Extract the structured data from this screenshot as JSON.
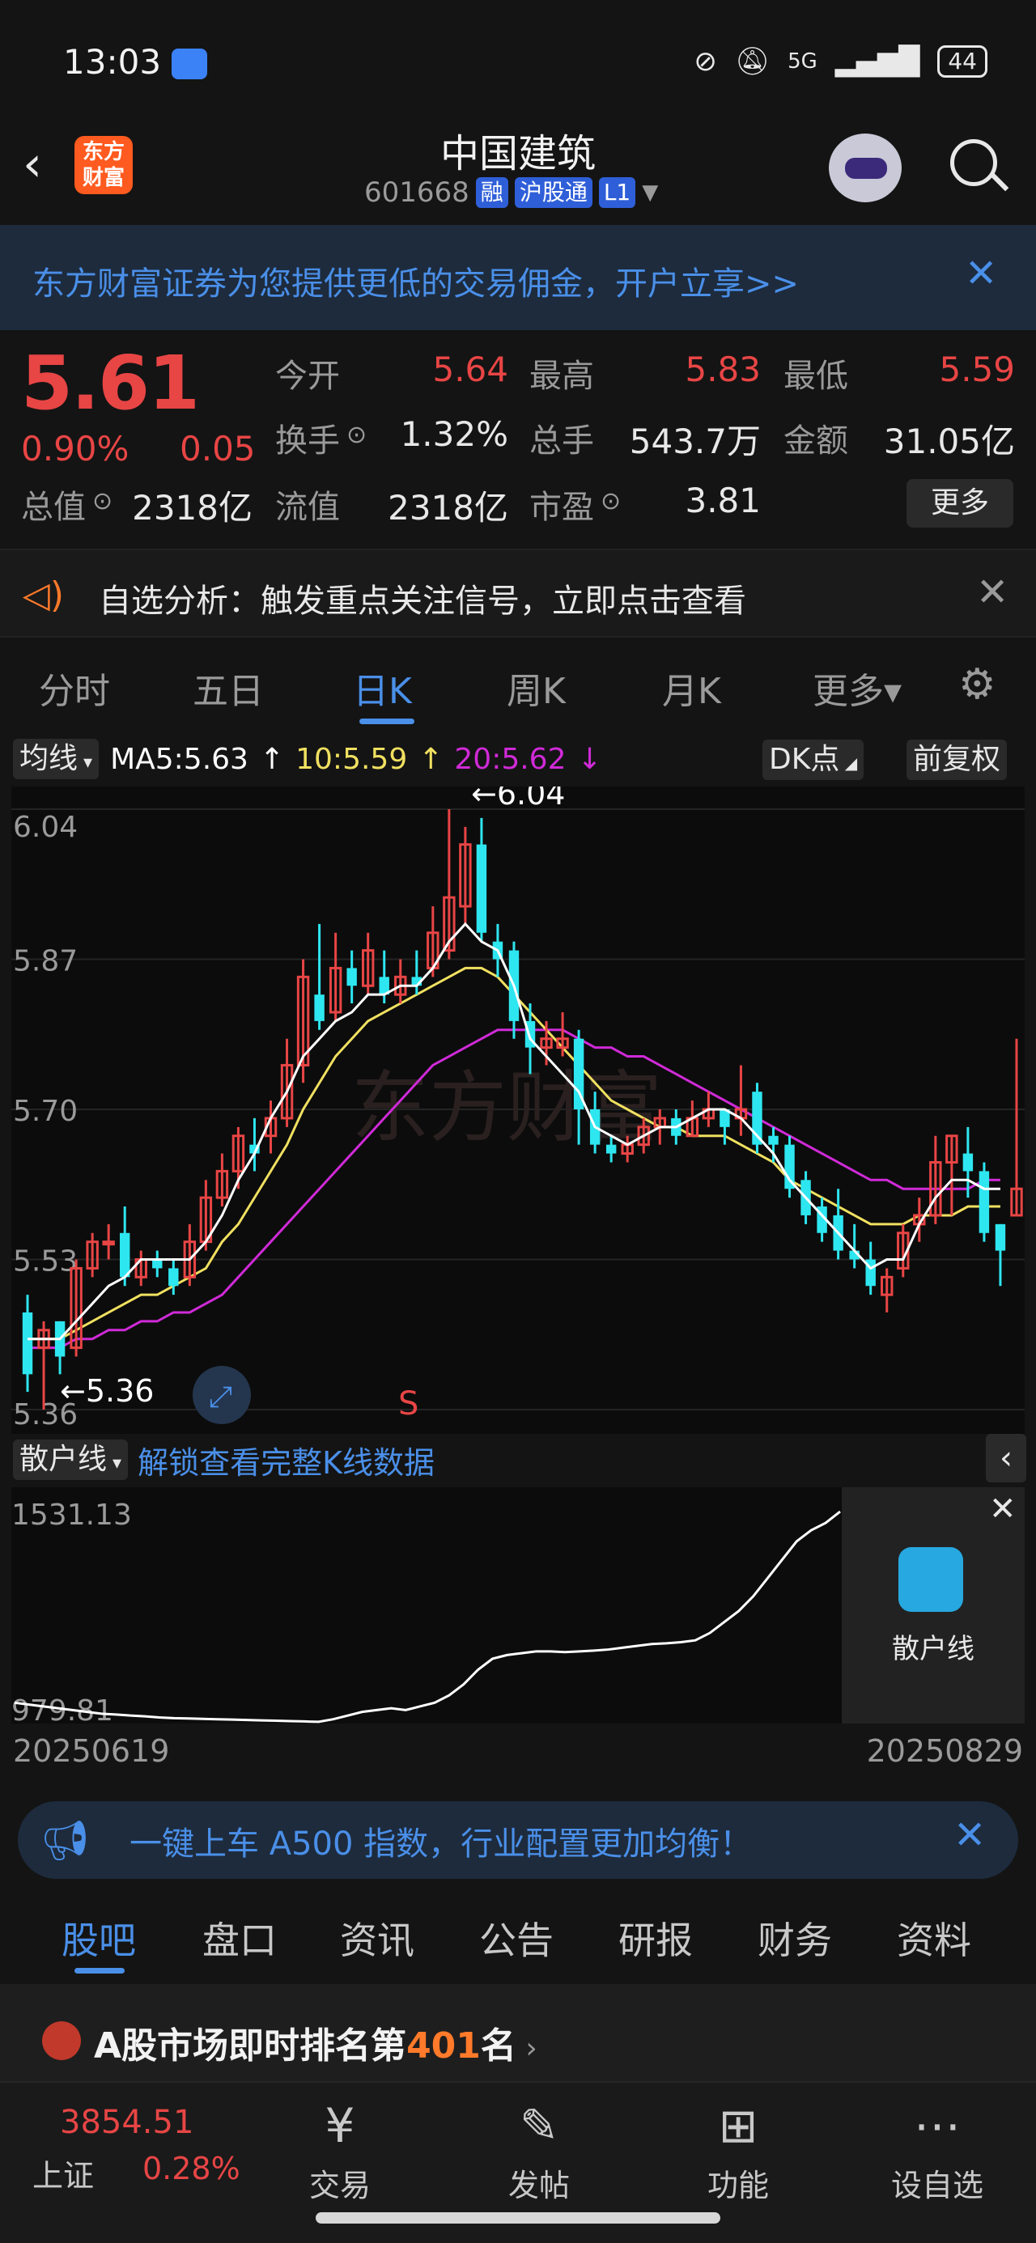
{
  "status_bar": {
    "time": "13:03",
    "network": "5G",
    "battery": "44"
  },
  "header": {
    "stock_name": "中国建筑",
    "code": "601668",
    "tags": [
      "融",
      "沪股通",
      "L1"
    ],
    "logo_text_line1": "东方",
    "logo_text_line2": "财富"
  },
  "promo": {
    "text": "东方财富证券为您提供更低的交易佣金，开户立享>>"
  },
  "quote": {
    "price": "5.61",
    "change_pct": "0.90%",
    "change": "0.05",
    "stats": [
      {
        "label": "今开",
        "value": "5.64",
        "color": "red"
      },
      {
        "label": "最高",
        "value": "5.83",
        "color": "red"
      },
      {
        "label": "最低",
        "value": "5.59",
        "color": "red"
      },
      {
        "label": "换手",
        "value": "1.32%",
        "color": "white"
      },
      {
        "label": "总手",
        "value": "543.7万",
        "color": "white"
      },
      {
        "label": "金额",
        "value": "31.05亿",
        "color": "white"
      },
      {
        "label": "总值",
        "value": "2318亿",
        "color": "white"
      },
      {
        "label": "流值",
        "value": "2318亿",
        "color": "white"
      },
      {
        "label": "市盈",
        "value": "3.81",
        "color": "white"
      }
    ],
    "more_label": "更多"
  },
  "analysis": {
    "text": "自选分析：触发重点关注信号，立即点击查看"
  },
  "tabs": [
    {
      "label": "分时",
      "active": false
    },
    {
      "label": "五日",
      "active": false
    },
    {
      "label": "日K",
      "active": true
    },
    {
      "label": "周K",
      "active": false
    },
    {
      "label": "月K",
      "active": false
    },
    {
      "label": "更多▾",
      "active": false
    }
  ],
  "ma_row": {
    "selector": "均线",
    "ma5": "MA5:5.63",
    "ma10": "10:5.59",
    "ma20": "20:5.62",
    "dk": "DK点",
    "adjust": "前复权"
  },
  "colors": {
    "up": "#e84545",
    "down": "#2ee6f0",
    "ma5": "#ffffff",
    "ma10": "#f0e060",
    "ma20": "#d02ad8",
    "accent": "#4a8fe8"
  },
  "chart_data": {
    "type": "candlestick",
    "y_ticks": [
      "6.04",
      "5.87",
      "5.70",
      "5.53",
      "5.36"
    ],
    "ylim": [
      5.36,
      6.04
    ],
    "max_label": "6.04",
    "min_label": "5.36",
    "signal_label": "S",
    "watermark": "东方财富",
    "candles": [
      {
        "o": 5.47,
        "c": 5.4,
        "h": 5.49,
        "l": 5.38
      },
      {
        "o": 5.43,
        "c": 5.45,
        "h": 5.46,
        "l": 5.36
      },
      {
        "o": 5.46,
        "c": 5.42,
        "h": 5.46,
        "l": 5.4
      },
      {
        "o": 5.43,
        "c": 5.52,
        "h": 5.53,
        "l": 5.42
      },
      {
        "o": 5.52,
        "c": 5.55,
        "h": 5.56,
        "l": 5.51
      },
      {
        "o": 5.55,
        "c": 5.55,
        "h": 5.57,
        "l": 5.53
      },
      {
        "o": 5.56,
        "c": 5.51,
        "h": 5.59,
        "l": 5.5
      },
      {
        "o": 5.51,
        "c": 5.53,
        "h": 5.54,
        "l": 5.5
      },
      {
        "o": 5.53,
        "c": 5.52,
        "h": 5.54,
        "l": 5.51
      },
      {
        "o": 5.52,
        "c": 5.5,
        "h": 5.53,
        "l": 5.49
      },
      {
        "o": 5.51,
        "c": 5.55,
        "h": 5.57,
        "l": 5.5
      },
      {
        "o": 5.55,
        "c": 5.6,
        "h": 5.62,
        "l": 5.54
      },
      {
        "o": 5.6,
        "c": 5.63,
        "h": 5.65,
        "l": 5.59
      },
      {
        "o": 5.63,
        "c": 5.67,
        "h": 5.68,
        "l": 5.61
      },
      {
        "o": 5.66,
        "c": 5.65,
        "h": 5.69,
        "l": 5.63
      },
      {
        "o": 5.67,
        "c": 5.69,
        "h": 5.71,
        "l": 5.65
      },
      {
        "o": 5.69,
        "c": 5.75,
        "h": 5.78,
        "l": 5.68
      },
      {
        "o": 5.75,
        "c": 5.85,
        "h": 5.87,
        "l": 5.73
      },
      {
        "o": 5.83,
        "c": 5.8,
        "h": 5.91,
        "l": 5.79
      },
      {
        "o": 5.81,
        "c": 5.86,
        "h": 5.9,
        "l": 5.8
      },
      {
        "o": 5.86,
        "c": 5.84,
        "h": 5.88,
        "l": 5.82
      },
      {
        "o": 5.84,
        "c": 5.88,
        "h": 5.9,
        "l": 5.83
      },
      {
        "o": 5.85,
        "c": 5.83,
        "h": 5.88,
        "l": 5.82
      },
      {
        "o": 5.83,
        "c": 5.85,
        "h": 5.87,
        "l": 5.82
      },
      {
        "o": 5.85,
        "c": 5.84,
        "h": 5.88,
        "l": 5.83
      },
      {
        "o": 5.86,
        "c": 5.9,
        "h": 5.93,
        "l": 5.85
      },
      {
        "o": 5.88,
        "c": 5.94,
        "h": 6.04,
        "l": 5.87
      },
      {
        "o": 5.93,
        "c": 6.0,
        "h": 6.02,
        "l": 5.91
      },
      {
        "o": 6.0,
        "c": 5.9,
        "h": 6.03,
        "l": 5.89
      },
      {
        "o": 5.89,
        "c": 5.87,
        "h": 5.91,
        "l": 5.85
      },
      {
        "o": 5.88,
        "c": 5.8,
        "h": 5.89,
        "l": 5.78
      },
      {
        "o": 5.8,
        "c": 5.77,
        "h": 5.82,
        "l": 5.74
      },
      {
        "o": 5.77,
        "c": 5.78,
        "h": 5.8,
        "l": 5.75
      },
      {
        "o": 5.77,
        "c": 5.78,
        "h": 5.81,
        "l": 5.76
      },
      {
        "o": 5.78,
        "c": 5.7,
        "h": 5.79,
        "l": 5.66
      },
      {
        "o": 5.7,
        "c": 5.66,
        "h": 5.72,
        "l": 5.65
      },
      {
        "o": 5.66,
        "c": 5.65,
        "h": 5.67,
        "l": 5.64
      },
      {
        "o": 5.65,
        "c": 5.66,
        "h": 5.67,
        "l": 5.64
      },
      {
        "o": 5.66,
        "c": 5.68,
        "h": 5.69,
        "l": 5.65
      },
      {
        "o": 5.68,
        "c": 5.69,
        "h": 5.7,
        "l": 5.66
      },
      {
        "o": 5.69,
        "c": 5.67,
        "h": 5.7,
        "l": 5.66
      },
      {
        "o": 5.67,
        "c": 5.69,
        "h": 5.71,
        "l": 5.67
      },
      {
        "o": 5.69,
        "c": 5.7,
        "h": 5.72,
        "l": 5.68
      },
      {
        "o": 5.7,
        "c": 5.68,
        "h": 5.7,
        "l": 5.66
      },
      {
        "o": 5.69,
        "c": 5.7,
        "h": 5.75,
        "l": 5.67
      },
      {
        "o": 5.72,
        "c": 5.66,
        "h": 5.73,
        "l": 5.65
      },
      {
        "o": 5.67,
        "c": 5.66,
        "h": 5.68,
        "l": 5.64
      },
      {
        "o": 5.66,
        "c": 5.61,
        "h": 5.67,
        "l": 5.6
      },
      {
        "o": 5.62,
        "c": 5.58,
        "h": 5.63,
        "l": 5.57
      },
      {
        "o": 5.59,
        "c": 5.56,
        "h": 5.6,
        "l": 5.55
      },
      {
        "o": 5.58,
        "c": 5.54,
        "h": 5.61,
        "l": 5.53
      },
      {
        "o": 5.54,
        "c": 5.53,
        "h": 5.57,
        "l": 5.52
      },
      {
        "o": 5.53,
        "c": 5.5,
        "h": 5.55,
        "l": 5.49
      },
      {
        "o": 5.49,
        "c": 5.51,
        "h": 5.52,
        "l": 5.47
      },
      {
        "o": 5.52,
        "c": 5.56,
        "h": 5.57,
        "l": 5.51
      },
      {
        "o": 5.57,
        "c": 5.58,
        "h": 5.6,
        "l": 5.55
      },
      {
        "o": 5.58,
        "c": 5.64,
        "h": 5.67,
        "l": 5.57
      },
      {
        "o": 5.64,
        "c": 5.67,
        "h": 5.67,
        "l": 5.58
      },
      {
        "o": 5.65,
        "c": 5.63,
        "h": 5.68,
        "l": 5.6
      },
      {
        "o": 5.63,
        "c": 5.56,
        "h": 5.64,
        "l": 5.55
      },
      {
        "o": 5.57,
        "c": 5.54,
        "h": 5.57,
        "l": 5.5
      },
      {
        "o": 5.58,
        "c": 5.61,
        "h": 5.78,
        "l": 5.58
      }
    ],
    "ma5": [
      5.44,
      5.44,
      5.44,
      5.46,
      5.48,
      5.5,
      5.51,
      5.53,
      5.53,
      5.53,
      5.53,
      5.55,
      5.58,
      5.62,
      5.65,
      5.69,
      5.72,
      5.76,
      5.78,
      5.8,
      5.81,
      5.83,
      5.83,
      5.84,
      5.84,
      5.86,
      5.89,
      5.91,
      5.89,
      5.88,
      5.84,
      5.78,
      5.76,
      5.74,
      5.72,
      5.68,
      5.67,
      5.66,
      5.67,
      5.68,
      5.68,
      5.69,
      5.7,
      5.7,
      5.69,
      5.67,
      5.65,
      5.62,
      5.6,
      5.58,
      5.56,
      5.54,
      5.52,
      5.53,
      5.53,
      5.57,
      5.6,
      5.62,
      5.62,
      5.61,
      5.61
    ],
    "ma10": [
      5.44,
      5.44,
      5.44,
      5.45,
      5.46,
      5.47,
      5.48,
      5.49,
      5.49,
      5.5,
      5.51,
      5.52,
      5.55,
      5.57,
      5.6,
      5.63,
      5.66,
      5.7,
      5.73,
      5.76,
      5.78,
      5.8,
      5.81,
      5.82,
      5.83,
      5.84,
      5.85,
      5.86,
      5.86,
      5.85,
      5.83,
      5.81,
      5.79,
      5.77,
      5.75,
      5.73,
      5.71,
      5.7,
      5.69,
      5.68,
      5.68,
      5.67,
      5.67,
      5.67,
      5.66,
      5.65,
      5.64,
      5.62,
      5.61,
      5.6,
      5.59,
      5.58,
      5.57,
      5.57,
      5.57,
      5.58,
      5.58,
      5.58,
      5.59,
      5.59,
      5.59
    ],
    "ma20": [
      5.43,
      5.43,
      5.43,
      5.44,
      5.44,
      5.45,
      5.45,
      5.46,
      5.46,
      5.47,
      5.47,
      5.48,
      5.49,
      5.51,
      5.53,
      5.55,
      5.57,
      5.59,
      5.61,
      5.63,
      5.65,
      5.67,
      5.69,
      5.71,
      5.73,
      5.75,
      5.76,
      5.77,
      5.78,
      5.79,
      5.79,
      5.79,
      5.79,
      5.79,
      5.78,
      5.77,
      5.77,
      5.76,
      5.76,
      5.75,
      5.74,
      5.73,
      5.72,
      5.71,
      5.7,
      5.69,
      5.68,
      5.67,
      5.66,
      5.65,
      5.64,
      5.63,
      5.62,
      5.62,
      5.61,
      5.61,
      5.61,
      5.61,
      5.61,
      5.62,
      5.62
    ]
  },
  "sub_indicator": {
    "selector": "散户线",
    "unlock_text": "解锁查看完整K线数据",
    "max_label": "1531.13",
    "min_label": "979.81",
    "lock_label": "散户线",
    "values": [
      1010,
      1005,
      1000,
      995,
      990,
      985,
      980,
      978,
      975,
      973,
      970,
      968,
      967,
      966,
      965,
      964,
      963,
      962,
      961,
      960,
      959,
      958,
      965,
      975,
      985,
      990,
      995,
      990,
      1000,
      1010,
      1030,
      1060,
      1100,
      1130,
      1140,
      1145,
      1150,
      1150,
      1148,
      1150,
      1152,
      1155,
      1160,
      1165,
      1170,
      1172,
      1175,
      1180,
      1200,
      1230,
      1260,
      1300,
      1350,
      1400,
      1450,
      1480,
      1500,
      1531
    ],
    "date_start": "20250619",
    "date_end": "20250829"
  },
  "ad": {
    "text": "一键上车 A500 指数，行业配置更加均衡！"
  },
  "section_tabs": [
    {
      "label": "股吧",
      "active": true
    },
    {
      "label": "盘口",
      "active": false
    },
    {
      "label": "资讯",
      "active": false
    },
    {
      "label": "公告",
      "active": false
    },
    {
      "label": "研报",
      "active": false
    },
    {
      "label": "财务",
      "active": false
    },
    {
      "label": "资料",
      "active": false
    }
  ],
  "ranking": {
    "prefix": "A股市场即时排名第",
    "rank": "401",
    "suffix": "名"
  },
  "bottom_nav": {
    "index_value": "3854.51",
    "index_name": "上证",
    "index_pct": "0.28%",
    "items": [
      {
        "label": "交易",
        "icon": "¥"
      },
      {
        "label": "发帖",
        "icon": "✎"
      },
      {
        "label": "功能",
        "icon": "⊞"
      },
      {
        "label": "设自选",
        "icon": "⋯"
      }
    ]
  }
}
